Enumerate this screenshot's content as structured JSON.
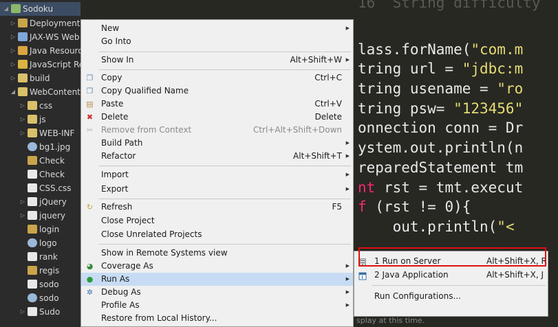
{
  "explorer": {
    "items": [
      {
        "label": "Sodoku",
        "twisty": "◢",
        "icon": "#8bb86b"
      },
      {
        "label": "Deployment Descriptor",
        "twisty": "▷",
        "icon": "#c9a44a"
      },
      {
        "label": "JAX-WS Web Services",
        "twisty": "▷",
        "icon": "#7fa7d9"
      },
      {
        "label": "Java Resources",
        "twisty": "▷",
        "icon": "#d9a441"
      },
      {
        "label": "JavaScript Resources",
        "twisty": "▷",
        "icon": "#d9b441"
      },
      {
        "label": "build",
        "twisty": "▷",
        "icon": "#d9c06a"
      },
      {
        "label": "WebContent",
        "twisty": "◢",
        "icon": "#d9c06a"
      },
      {
        "label": "css",
        "twisty": "▷",
        "icon": "#d9c06a"
      },
      {
        "label": "js",
        "twisty": "▷",
        "icon": "#d9c06a"
      },
      {
        "label": "WEB-INF",
        "twisty": "▷",
        "icon": "#d9c06a"
      },
      {
        "label": "bg1.jpg",
        "twisty": "",
        "icon": "#9ab8d8"
      },
      {
        "label": "Check",
        "twisty": "",
        "icon": "#c9a44a"
      },
      {
        "label": "Check",
        "twisty": "",
        "icon": "#e8e8e8"
      },
      {
        "label": "CSS.css",
        "twisty": "",
        "icon": "#e8e8e8"
      },
      {
        "label": "jQuery",
        "twisty": "▷",
        "icon": "#e8e8e8"
      },
      {
        "label": "jquery",
        "twisty": "▷",
        "icon": "#e8e8e8"
      },
      {
        "label": "login",
        "twisty": "",
        "icon": "#c9a44a"
      },
      {
        "label": "logo",
        "twisty": "",
        "icon": "#9ab8d8"
      },
      {
        "label": "rank",
        "twisty": "",
        "icon": "#e8e8e8"
      },
      {
        "label": "regis",
        "twisty": "",
        "icon": "#c9a44a"
      },
      {
        "label": "sodo",
        "twisty": "",
        "icon": "#e8e8e8"
      },
      {
        "label": "sodo",
        "twisty": "",
        "icon": "#9ab8d8"
      },
      {
        "label": "Sudo",
        "twisty": "▷",
        "icon": "#e8e8e8"
      }
    ]
  },
  "editor": {
    "lines": [
      {
        "num": "16",
        "text": "String difficulty"
      },
      {
        "text": "lass.forName(\"com.m"
      },
      {
        "text": "tring url = \"jdbc:m"
      },
      {
        "text": "tring usename = \"ro"
      },
      {
        "text": "tring psw= \"123456\""
      },
      {
        "text": "onnection conn = Dr"
      },
      {
        "text": "ystem.out.println(n"
      },
      {
        "text": "reparedStatement tm"
      },
      {
        "text": "nt rst = tmt.execut"
      },
      {
        "text": "f (rst != 0){"
      },
      {
        "text": "    out.println(\"<"
      }
    ],
    "status_text": "splay at this time."
  },
  "context_menu": {
    "items": [
      {
        "label": "New",
        "accel": "",
        "submenu": true,
        "icon": ""
      },
      {
        "label": "Go Into",
        "accel": "",
        "submenu": false,
        "icon": ""
      },
      {
        "label": "Show In",
        "accel": "Alt+Shift+W",
        "submenu": true,
        "icon": ""
      },
      {
        "label": "Copy",
        "accel": "Ctrl+C",
        "submenu": false,
        "icon": "copy"
      },
      {
        "label": "Copy Qualified Name",
        "accel": "",
        "submenu": false,
        "icon": "copy"
      },
      {
        "label": "Paste",
        "accel": "Ctrl+V",
        "submenu": false,
        "icon": "paste"
      },
      {
        "label": "Delete",
        "accel": "Delete",
        "submenu": false,
        "icon": "delete"
      },
      {
        "label": "Remove from Context",
        "accel": "Ctrl+Alt+Shift+Down",
        "submenu": false,
        "icon": "remove",
        "disabled": true
      },
      {
        "label": "Build Path",
        "accel": "",
        "submenu": true,
        "icon": ""
      },
      {
        "label": "Refactor",
        "accel": "Alt+Shift+T",
        "submenu": true,
        "icon": ""
      },
      {
        "label": "Import",
        "accel": "",
        "submenu": true,
        "icon": ""
      },
      {
        "label": "Export",
        "accel": "",
        "submenu": true,
        "icon": ""
      },
      {
        "label": "Refresh",
        "accel": "F5",
        "submenu": false,
        "icon": "refresh"
      },
      {
        "label": "Close Project",
        "accel": "",
        "submenu": false,
        "icon": ""
      },
      {
        "label": "Close Unrelated Projects",
        "accel": "",
        "submenu": false,
        "icon": ""
      },
      {
        "label": "Show in Remote Systems view",
        "accel": "",
        "submenu": false,
        "icon": ""
      },
      {
        "label": "Coverage As",
        "accel": "",
        "submenu": true,
        "icon": "coverage"
      },
      {
        "label": "Run As",
        "accel": "",
        "submenu": true,
        "icon": "run",
        "highlight": true
      },
      {
        "label": "Debug As",
        "accel": "",
        "submenu": true,
        "icon": "debug"
      },
      {
        "label": "Profile As",
        "accel": "",
        "submenu": true,
        "icon": ""
      },
      {
        "label": "Restore from Local History...",
        "accel": "",
        "submenu": false,
        "icon": ""
      }
    ]
  },
  "run_as_submenu": {
    "items": [
      {
        "label": "1 Run on Server",
        "accel": "Alt+Shift+X, R",
        "icon": "server"
      },
      {
        "label": "2 Java Application",
        "accel": "Alt+Shift+X, J",
        "icon": "java-app"
      },
      {
        "label": "Run Configurations...",
        "accel": "",
        "icon": ""
      }
    ]
  },
  "colors": {
    "selection_highlight": "#c7dcf4",
    "callout_box": "#e01010",
    "editor_bg": "#272822",
    "string": "#e6db74",
    "keyword": "#f92672"
  }
}
